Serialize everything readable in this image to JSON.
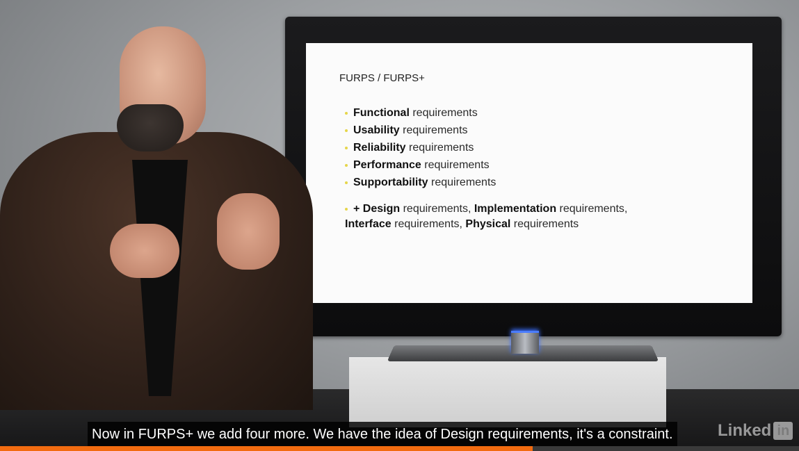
{
  "slide": {
    "title": "FURPS / FURPS+",
    "items": [
      {
        "bold": "Functional",
        "rest": " requirements"
      },
      {
        "bold": "Usability",
        "rest": " requirements"
      },
      {
        "bold": "Reliability",
        "rest": " requirements"
      },
      {
        "bold": "Performance",
        "rest": " requirements"
      },
      {
        "bold": "Supportability",
        "rest": " requirements"
      }
    ],
    "extra": {
      "prefix": "+ ",
      "p1_bold": "Design",
      "p1_rest": " requirements, ",
      "p2_bold": "Implementation",
      "p2_rest": " requirements,",
      "p3_bold": "Interface",
      "p3_rest": " requirements, ",
      "p4_bold": "Physical",
      "p4_rest": " requirements"
    }
  },
  "caption": {
    "text": "Now in FURPS+ we add four more. We have the idea of Design requirements, it's a constraint."
  },
  "logo": {
    "word": "Linked",
    "badge": "in"
  },
  "progress": {
    "fraction": 0.667,
    "color": "#f26b10"
  }
}
